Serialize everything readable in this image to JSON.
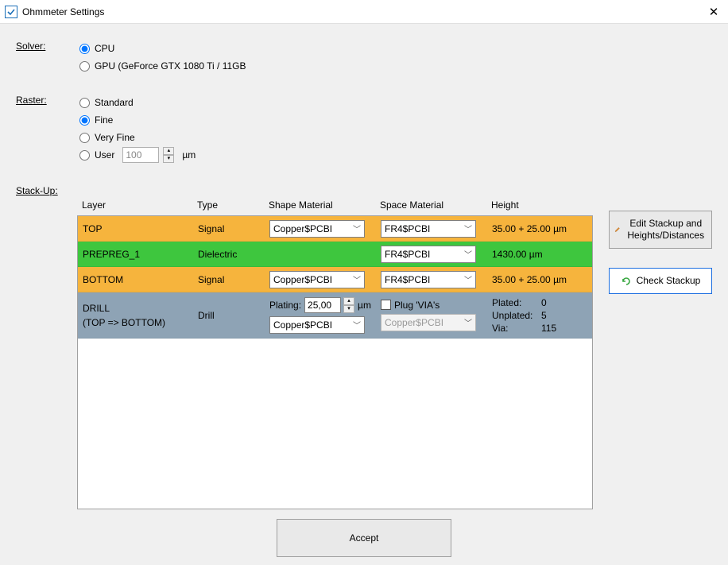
{
  "window": {
    "title": "Ohmmeter Settings"
  },
  "labels": {
    "solver": "Solver:",
    "raster": "Raster:",
    "stackup": "Stack-Up:"
  },
  "solver": {
    "cpu_label": "CPU",
    "gpu_label": "GPU (GeForce GTX 1080 Ti / 11GB",
    "selected": "cpu"
  },
  "raster": {
    "standard_label": "Standard",
    "fine_label": "Fine",
    "veryfine_label": "Very Fine",
    "user_label": "User",
    "user_value": "100",
    "user_unit": "µm",
    "selected": "fine"
  },
  "table": {
    "headers": {
      "layer": "Layer",
      "type": "Type",
      "shape": "Shape Material",
      "space": "Space Material",
      "height": "Height"
    },
    "rows": [
      {
        "layer": "TOP",
        "type": "Signal",
        "shape": "Copper$PCBI",
        "space": "FR4$PCBI",
        "height": "35.00 + 25.00 µm",
        "kind": "signal"
      },
      {
        "layer": "PREPREG_1",
        "type": "Dielectric",
        "shape": "",
        "space": "FR4$PCBI",
        "height": "1430.00 µm",
        "kind": "dielectric"
      },
      {
        "layer": "BOTTOM",
        "type": "Signal",
        "shape": "Copper$PCBI",
        "space": "FR4$PCBI",
        "height": "35.00 + 25.00 µm",
        "kind": "signal"
      }
    ],
    "drill": {
      "layer": "DRILL",
      "sublayer": "(TOP => BOTTOM)",
      "type": "Drill",
      "plating_label": "Plating:",
      "plating_value": "25,00",
      "plating_unit": "µm",
      "plug_label": "Plug 'VIA's",
      "shape": "Copper$PCBI",
      "space": "Copper$PCBI",
      "stats": {
        "plated_label": "Plated:",
        "plated_val": "0",
        "unplated_label": "Unplated:",
        "unplated_val": "5",
        "via_label": "Via:",
        "via_val": "115"
      }
    }
  },
  "buttons": {
    "edit_stackup": "Edit Stackup and Heights/Distances",
    "check_stackup": "Check Stackup",
    "accept": "Accept"
  }
}
